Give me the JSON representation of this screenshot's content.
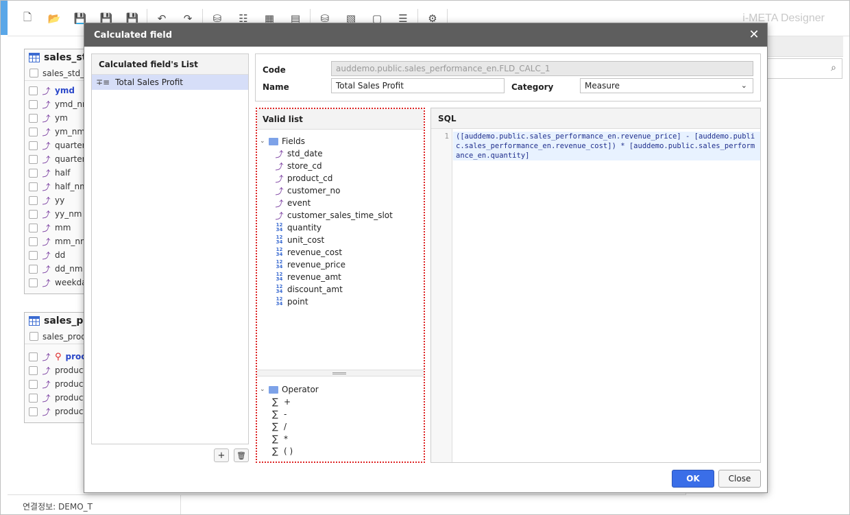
{
  "app": {
    "title": "i-META Designer"
  },
  "toolbar": {
    "icons": [
      "new-document-icon",
      "open-folder-icon",
      "save-icon",
      "save-all-icon",
      "save-as-icon",
      "undo-icon",
      "redo-icon",
      "database-icon",
      "hierarchy-icon",
      "table-icon",
      "view-icon",
      "datasource-icon",
      "report-icon",
      "document-icon",
      "tree-icon",
      "settings-icon"
    ]
  },
  "canvas": {
    "entity1": {
      "title": "sales_std",
      "sub": "sales_std_",
      "rows": [
        "ymd",
        "ymd_nm",
        "ym",
        "ym_nm",
        "quarter",
        "quarter",
        "half",
        "half_nm",
        "yy",
        "yy_nm",
        "mm",
        "mm_nm",
        "dd",
        "dd_nm",
        "weekda"
      ]
    },
    "entity2": {
      "title": "sales_pr",
      "sub": "sales_prod",
      "rows": [
        "proc",
        "product",
        "product",
        "product",
        "product"
      ]
    }
  },
  "status": {
    "text": "연결정보: DEMO_T"
  },
  "modal": {
    "title": "Calculated field",
    "close_symbol": "✕",
    "list": {
      "header": "Calculated field's List",
      "items": [
        {
          "label": "Total Sales Profit"
        }
      ]
    },
    "form": {
      "code_label": "Code",
      "code_value": "auddemo.public.sales_performance_en.FLD_CALC_1",
      "name_label": "Name",
      "name_value": "Total Sales Profit",
      "category_label": "Category",
      "category_value": "Measure"
    },
    "valid": {
      "header": "Valid list",
      "fields_label": "Fields",
      "fields": [
        {
          "label": "std_date",
          "kind": "dimension"
        },
        {
          "label": "store_cd",
          "kind": "dimension"
        },
        {
          "label": "product_cd",
          "kind": "dimension"
        },
        {
          "label": "customer_no",
          "kind": "dimension"
        },
        {
          "label": "event",
          "kind": "dimension"
        },
        {
          "label": "customer_sales_time_slot",
          "kind": "dimension"
        },
        {
          "label": "quantity",
          "kind": "measure"
        },
        {
          "label": "unit_cost",
          "kind": "measure"
        },
        {
          "label": "revenue_cost",
          "kind": "measure"
        },
        {
          "label": "revenue_price",
          "kind": "measure"
        },
        {
          "label": "revenue_amt",
          "kind": "measure"
        },
        {
          "label": "discount_amt",
          "kind": "measure"
        },
        {
          "label": "point",
          "kind": "measure"
        }
      ],
      "operator_label": "Operator",
      "operators": [
        "+",
        "-",
        "/",
        "*",
        "( )"
      ]
    },
    "sql": {
      "header": "SQL",
      "line_number": "1",
      "code": "([auddemo.public.sales_performance_en.revenue_price] - [auddemo.public.sales_performance_en.revenue_cost]) * [auddemo.public.sales_performance_en.quantity]"
    },
    "buttons": {
      "ok": "OK",
      "close": "Close",
      "add": "+",
      "delete": "🗑"
    }
  },
  "colors": {
    "accent": "#3a6ee8",
    "titlebar": "#5e5e5e",
    "selection": "#d6def8",
    "highlight_border": "#dd2222"
  }
}
